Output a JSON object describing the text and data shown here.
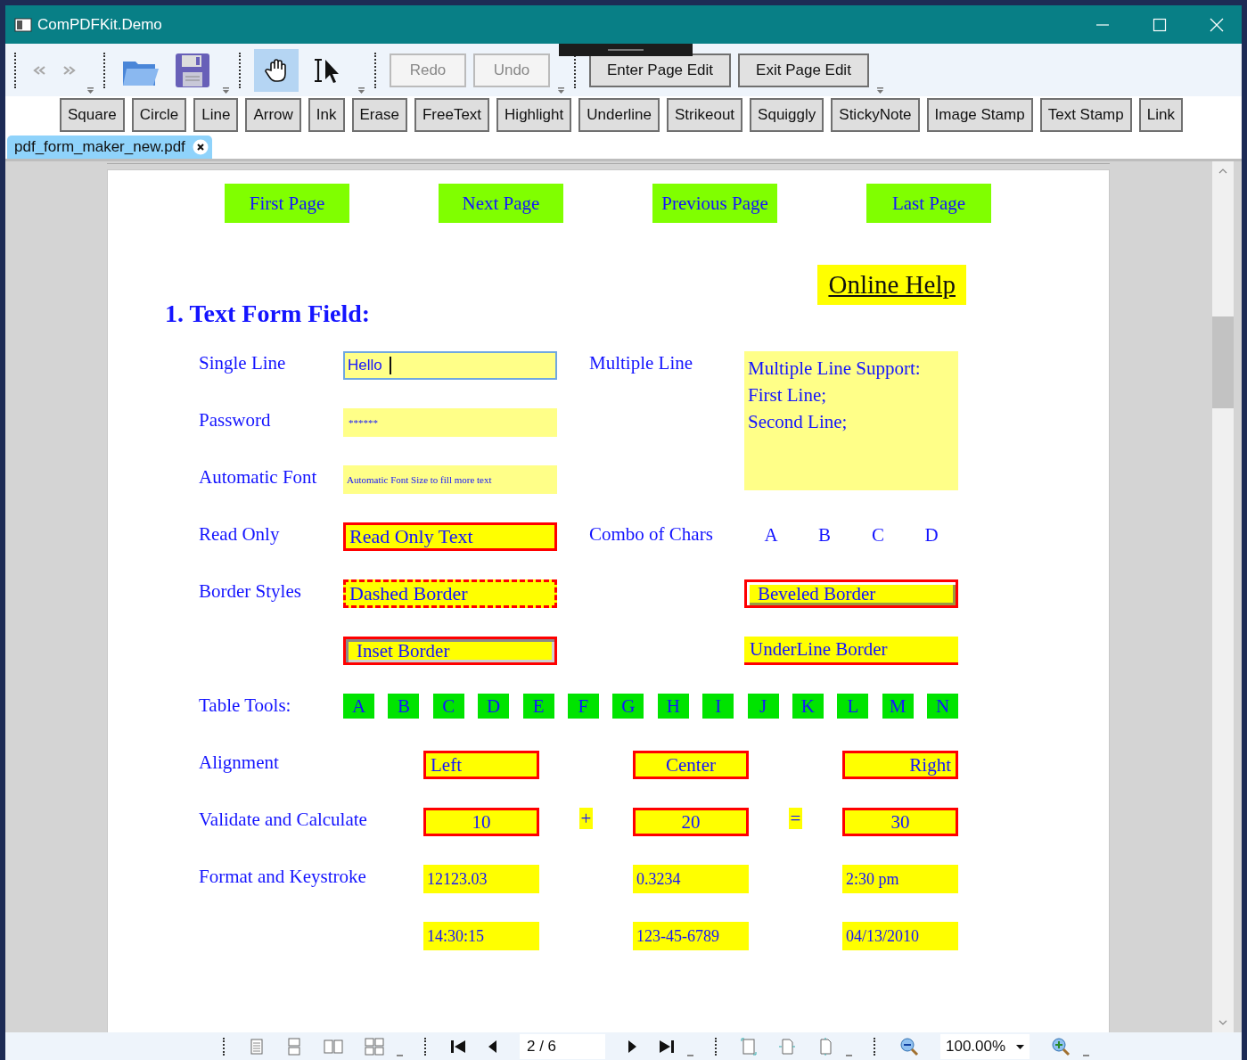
{
  "window": {
    "title": "ComPDFKit.Demo"
  },
  "toolbar": {
    "history": [
      {
        "disabled": true
      },
      {
        "disabled": true
      }
    ],
    "modes": [
      {
        "selected": true
      },
      {
        "selected": false
      }
    ],
    "edit_buttons": [
      {
        "label": "Redo",
        "disabled": true
      },
      {
        "label": "Undo",
        "disabled": true
      },
      {
        "label": "Enter Page Edit",
        "disabled": false
      },
      {
        "label": "Exit Page Edit",
        "disabled": false
      }
    ]
  },
  "annotation_tools": [
    "Square",
    "Circle",
    "Line",
    "Arrow",
    "Ink",
    "Erase",
    "FreeText",
    "Highlight",
    "Underline",
    "Strikeout",
    "Squiggly",
    "StickyNote",
    "Image Stamp",
    "Text Stamp",
    "Link"
  ],
  "tabs": [
    {
      "label": "pdf_form_maker_new.pdf",
      "selected": true
    }
  ],
  "page": {
    "nav_buttons": [
      "First Page",
      "Next Page",
      "Previous Page",
      "Last Page"
    ],
    "online_help": "Online Help",
    "heading": "1. Text Form Field:",
    "rows": [
      {
        "label": "Single Line",
        "field": {
          "value": "Hello",
          "kind": "focused"
        },
        "right_label": "Multiple Line"
      },
      {
        "label": "Password",
        "field": {
          "value": "******",
          "kind": "pale"
        }
      },
      {
        "label": "Automatic Font",
        "field": {
          "value": "Automatic Font Size to fill more text",
          "kind": "autosize"
        }
      },
      {
        "label": "Read Only",
        "field": {
          "value": "Read Only Text",
          "kind": "readonly"
        },
        "right_label": "Combo of Chars",
        "chars": [
          "A",
          "B",
          "C",
          "D"
        ]
      },
      {
        "label": "Border Styles",
        "field": {
          "value": "Dashed Border",
          "kind": "dashed"
        },
        "right_field": {
          "value": "Beveled Border",
          "kind": "beveled"
        }
      },
      {
        "field": {
          "value": "Inset Border",
          "kind": "inset"
        },
        "right_field": {
          "value": "UnderLine Border",
          "kind": "underline"
        }
      }
    ],
    "multiline_field": {
      "lines": [
        "Multiple Line Support:",
        "First Line;",
        "Second Line;"
      ]
    },
    "table_tools": {
      "label": "Table Tools:",
      "cells": [
        "A",
        "B",
        "C",
        "D",
        "E",
        "F",
        "G",
        "H",
        "I",
        "J",
        "K",
        "L",
        "M",
        "N"
      ]
    },
    "calc_rows": [
      {
        "label": "Alignment",
        "fields": [
          {
            "value": "Left",
            "kind": "boxleft"
          },
          {
            "value": "Center",
            "kind": "boxcenter"
          },
          {
            "value": "Right",
            "kind": "boxright"
          }
        ]
      },
      {
        "label": "Validate and Calculate",
        "fields": [
          {
            "value": "10",
            "kind": "boxcenter"
          },
          {
            "value": "20",
            "kind": "boxcenter"
          },
          {
            "value": "30",
            "kind": "boxcenter"
          }
        ],
        "operators": [
          "+",
          "="
        ]
      },
      {
        "label": "Format and Keystroke",
        "fields": [
          {
            "value": "12123.03",
            "kind": "plain"
          },
          {
            "value": "0.3234",
            "kind": "plain"
          },
          {
            "value": "2:30 pm",
            "kind": "plain"
          }
        ]
      },
      {
        "fields": [
          {
            "value": "14:30:15",
            "kind": "plain"
          },
          {
            "value": "123-45-6789",
            "kind": "plain"
          },
          {
            "value": "04/13/2010",
            "kind": "plain"
          }
        ]
      }
    ]
  },
  "status_bar": {
    "page": "2 / 6",
    "zoom": "100.00%"
  }
}
